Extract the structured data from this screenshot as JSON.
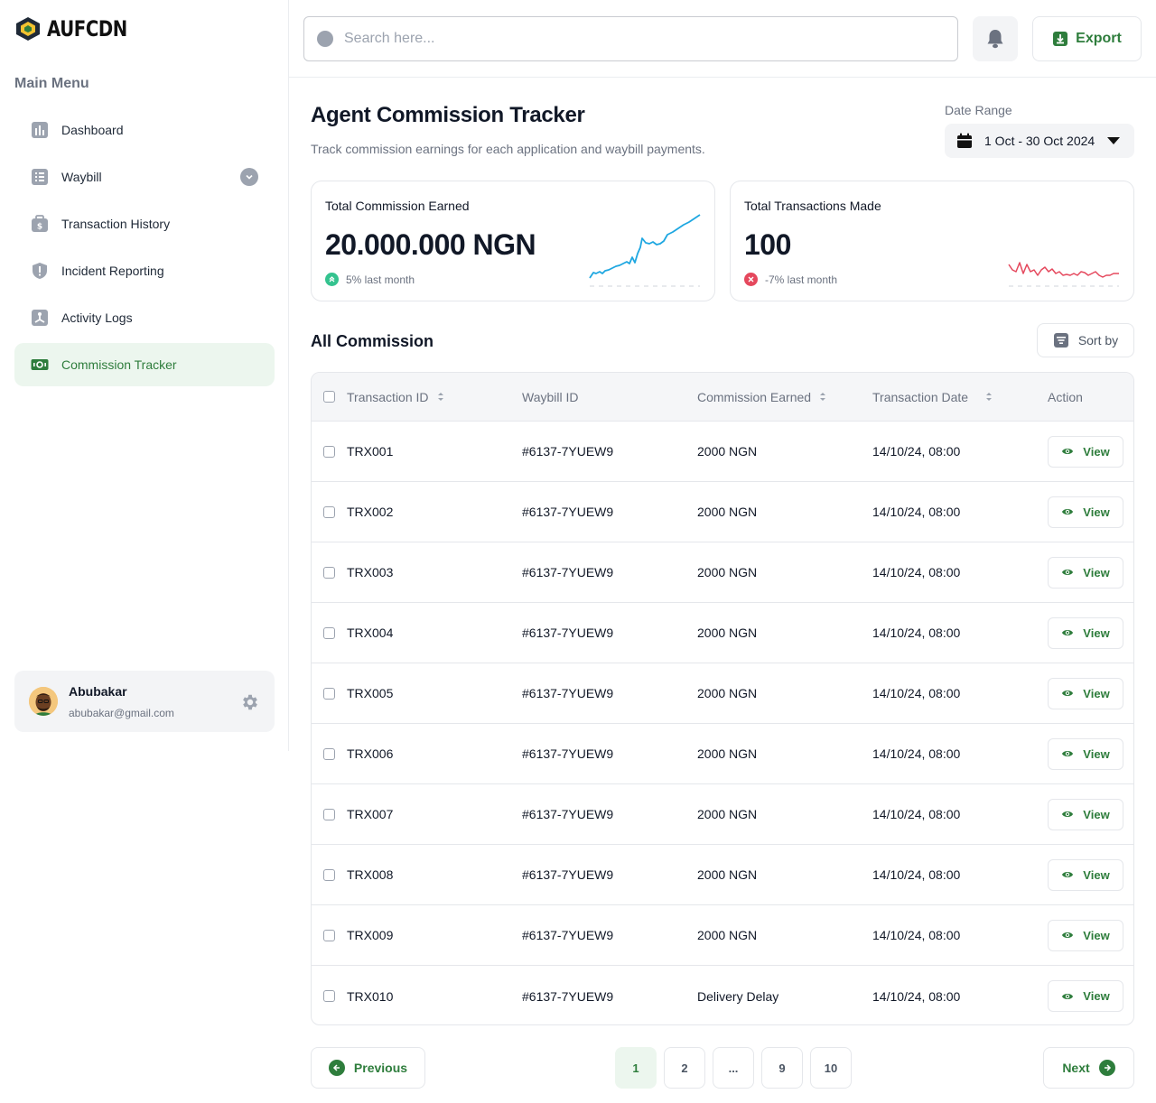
{
  "brand": {
    "name": "AUFCDN"
  },
  "sidebar": {
    "menu_title": "Main Menu",
    "items": [
      {
        "label": "Dashboard",
        "icon": "dashboard-icon"
      },
      {
        "label": "Waybill",
        "icon": "waybill-icon",
        "has_chevron": true
      },
      {
        "label": "Transaction History",
        "icon": "wallet-icon"
      },
      {
        "label": "Incident Reporting",
        "icon": "shield-icon"
      },
      {
        "label": "Activity Logs",
        "icon": "activity-icon"
      },
      {
        "label": "Commission Tracker",
        "icon": "money-icon",
        "active": true
      }
    ],
    "user": {
      "name": "Abubakar",
      "email": "abubakar@gmail.com"
    }
  },
  "header": {
    "search_placeholder": "Search here...",
    "export_label": "Export"
  },
  "page": {
    "title": "Agent Commission Tracker",
    "subtitle": "Track commission earnings for each application and waybill payments.",
    "date_range_label": "Date Range",
    "date_range_value": "1 Oct - 30 Oct 2024"
  },
  "stats": [
    {
      "title": "Total Commission Earned",
      "value": "20.000.000 NGN",
      "trend": "5% last month",
      "direction": "up",
      "color": "#1ea7e1"
    },
    {
      "title": "Total Transactions Made",
      "value": "100",
      "trend": "-7% last month",
      "direction": "down",
      "color": "#e5485d"
    }
  ],
  "section": {
    "title": "All Commission",
    "sort_label": "Sort by"
  },
  "table": {
    "columns": [
      "Transaction ID",
      "Waybill ID",
      "Commission Earned",
      "Transaction Date",
      "Action"
    ],
    "rows": [
      [
        "TRX001",
        "#6137-7YUEW9",
        "2000 NGN",
        "14/10/24, 08:00"
      ],
      [
        "TRX002",
        "#6137-7YUEW9",
        "2000 NGN",
        "14/10/24, 08:00"
      ],
      [
        "TRX003",
        "#6137-7YUEW9",
        "2000 NGN",
        "14/10/24, 08:00"
      ],
      [
        "TRX004",
        "#6137-7YUEW9",
        "2000 NGN",
        "14/10/24, 08:00"
      ],
      [
        "TRX005",
        "#6137-7YUEW9",
        "2000 NGN",
        "14/10/24, 08:00"
      ],
      [
        "TRX006",
        "#6137-7YUEW9",
        "2000 NGN",
        "14/10/24, 08:00"
      ],
      [
        "TRX007",
        "#6137-7YUEW9",
        "2000 NGN",
        "14/10/24, 08:00"
      ],
      [
        "TRX008",
        "#6137-7YUEW9",
        "2000 NGN",
        "14/10/24, 08:00"
      ],
      [
        "TRX009",
        "#6137-7YUEW9",
        "2000 NGN",
        "14/10/24, 08:00"
      ],
      [
        "TRX010",
        "#6137-7YUEW9",
        "Delivery Delay",
        "14/10/24, 08:00"
      ]
    ],
    "action_label": "View"
  },
  "pagination": {
    "prev_label": "Previous",
    "next_label": "Next",
    "pages": [
      "1",
      "2",
      "...",
      "9",
      "10"
    ],
    "current": "1"
  },
  "colors": {
    "accent": "#2e7d3c",
    "accent_bg": "#ecf6ee"
  }
}
